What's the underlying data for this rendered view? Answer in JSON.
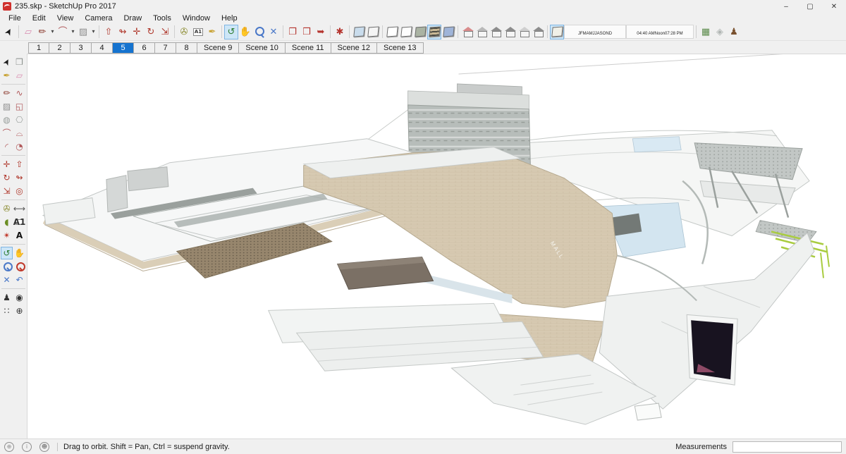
{
  "window": {
    "title": "235.skp - SketchUp Pro 2017",
    "controls": [
      {
        "name": "minimize-button",
        "glyph": "–"
      },
      {
        "name": "maximize-button",
        "glyph": "▢"
      },
      {
        "name": "close-button",
        "glyph": "✕"
      }
    ]
  },
  "menu": {
    "items": [
      "File",
      "Edit",
      "View",
      "Camera",
      "Draw",
      "Tools",
      "Window",
      "Help"
    ]
  },
  "toolbar": {
    "groups": [
      {
        "icons": [
          {
            "name": "select-tool-icon",
            "glyph": "➤",
            "color": "#1a1a1a",
            "cls": "rot-up"
          }
        ]
      },
      {
        "icons": [
          {
            "name": "eraser-tool-icon",
            "glyph": "▱",
            "color": "#d98cb0"
          },
          {
            "name": "line-tool-icon",
            "glyph": "✏",
            "color": "#8b3a2e"
          },
          {
            "name": "line-dropdown-icon",
            "kind": "drop",
            "glyph": "▾"
          },
          {
            "name": "arc-tool-icon",
            "glyph": "⌒",
            "color": "#b0585a"
          },
          {
            "name": "arc-dropdown-icon",
            "kind": "drop",
            "glyph": "▾"
          },
          {
            "name": "rectangle-tool-icon",
            "glyph": "▨",
            "color": "#8d8d8d"
          },
          {
            "name": "rectangle-dropdown-icon",
            "kind": "drop",
            "glyph": "▾"
          }
        ]
      },
      {
        "icons": [
          {
            "name": "pushpull-tool-icon",
            "glyph": "⇧",
            "color": "#b03a2e"
          },
          {
            "name": "followme-tool-icon",
            "glyph": "↬",
            "color": "#b03a2e"
          },
          {
            "name": "move-tool-icon",
            "glyph": "✛",
            "color": "#b03a2e"
          },
          {
            "name": "rotate-tool-icon",
            "glyph": "↻",
            "color": "#b03a2e"
          },
          {
            "name": "scale-tool-icon",
            "glyph": "⇲",
            "color": "#b03a2e"
          }
        ]
      },
      {
        "icons": [
          {
            "name": "tape-measure-tool-icon",
            "glyph": "✇",
            "color": "#8a8a2e"
          },
          {
            "name": "text-tool-icon",
            "kind": "badge",
            "glyph": "A1"
          },
          {
            "name": "paint-bucket-tool-icon",
            "glyph": "✒",
            "color": "#c8a233"
          }
        ]
      },
      {
        "icons": [
          {
            "name": "orbit-tool-icon",
            "glyph": "↺",
            "color": "#2e7d32",
            "active": true
          },
          {
            "name": "pan-tool-icon",
            "glyph": "✋",
            "color": "#d8b06a"
          },
          {
            "name": "zoom-tool-icon",
            "kind": "mag"
          },
          {
            "name": "zoom-extents-icon",
            "glyph": "✕",
            "color": "#4a78c8"
          }
        ]
      },
      {
        "icons": [
          {
            "name": "get-models-icon",
            "glyph": "❐",
            "color": "#b5342e"
          },
          {
            "name": "share-model-icon",
            "glyph": "❒",
            "color": "#b5342e"
          },
          {
            "name": "send-model-icon",
            "glyph": "➥",
            "color": "#b5342e"
          }
        ]
      },
      {
        "icons": [
          {
            "name": "extension-warehouse-icon",
            "glyph": "✱",
            "color": "#b5342e"
          }
        ]
      },
      {
        "icons": [
          {
            "name": "xray-style-icon",
            "kind": "cube",
            "color": "#c9dcec"
          },
          {
            "name": "back-edges-style-icon",
            "kind": "cube",
            "color": "#f5f5f5"
          }
        ]
      },
      {
        "icons": [
          {
            "name": "wireframe-style-icon",
            "kind": "cube",
            "color": "#ffffff"
          },
          {
            "name": "hidden-line-style-icon",
            "kind": "cube",
            "color": "#fdfdfd"
          },
          {
            "name": "shaded-style-icon",
            "kind": "cube",
            "color": "#aab3a3"
          },
          {
            "name": "shaded-textures-style-icon",
            "kind": "cubetex",
            "color": "#c9b896",
            "active": true
          },
          {
            "name": "monochrome-style-icon",
            "kind": "cube",
            "color": "#9fb4d8"
          }
        ]
      },
      {
        "icons": [
          {
            "name": "iso-view-icon",
            "kind": "house",
            "color": "#d98c8c"
          },
          {
            "name": "top-view-icon",
            "kind": "house",
            "color": "#b9b9b9"
          },
          {
            "name": "front-view-icon",
            "kind": "house",
            "color": "#8d8d8d"
          },
          {
            "name": "right-view-icon",
            "kind": "house",
            "color": "#8d8d8d"
          },
          {
            "name": "back-view-icon",
            "kind": "house",
            "color": "#cfcfcf"
          },
          {
            "name": "left-view-icon",
            "kind": "house",
            "color": "#8d8d8d"
          }
        ]
      },
      {
        "icons": [
          {
            "name": "shadows-toggle-icon",
            "kind": "cube",
            "color": "#f0f0e8",
            "active": true
          },
          {
            "name": "shadow-month-slider",
            "kind": "months"
          },
          {
            "name": "shadow-time-slider",
            "kind": "times"
          }
        ]
      },
      {
        "icons": [
          {
            "name": "add-location-icon",
            "glyph": "▦",
            "color": "#5a8a4a"
          },
          {
            "name": "toggle-terrain-icon",
            "glyph": "◈",
            "color": "#b0b5b3"
          },
          {
            "name": "photo-textures-icon",
            "glyph": "♟",
            "color": "#7a5230"
          }
        ]
      }
    ],
    "shadow": {
      "months": [
        "J",
        "F",
        "M",
        "A",
        "M",
        "J",
        "J",
        "A",
        "S",
        "O",
        "N",
        "D"
      ],
      "time_start": "04:40 AM",
      "time_mid": "Noon",
      "time_end": "07:28 PM"
    }
  },
  "scene_tabs": {
    "tabs": [
      {
        "label": "1"
      },
      {
        "label": "2"
      },
      {
        "label": "3"
      },
      {
        "label": "4"
      },
      {
        "label": "5",
        "active": true
      },
      {
        "label": "6"
      },
      {
        "label": "7"
      },
      {
        "label": "8"
      },
      {
        "label": "Scene 9"
      },
      {
        "label": "Scene 10"
      },
      {
        "label": "Scene 11"
      },
      {
        "label": "Scene 12"
      },
      {
        "label": "Scene 13"
      }
    ]
  },
  "left_toolbar": {
    "tools": [
      {
        "name": "select-tool",
        "glyph": "➤",
        "color": "#1a1a1a",
        "cls": "rot-up"
      },
      {
        "name": "make-component-tool",
        "glyph": "❒",
        "color": "#8a8f8c"
      },
      {
        "name": "paint-bucket-tool",
        "glyph": "✒",
        "color": "#c8a233"
      },
      {
        "name": "eraser-tool",
        "glyph": "▱",
        "color": "#d98cb0"
      },
      {
        "sep": true
      },
      {
        "name": "line-tool",
        "glyph": "✏",
        "color": "#8b3a2e"
      },
      {
        "name": "freehand-tool",
        "glyph": "∿",
        "color": "#b0585a"
      },
      {
        "name": "rectangle-tool",
        "glyph": "▨",
        "color": "#8d8d8d"
      },
      {
        "name": "rotated-rectangle-tool",
        "glyph": "◱",
        "color": "#b0585a"
      },
      {
        "name": "circle-tool",
        "glyph": "◍",
        "color": "#9aa09d"
      },
      {
        "name": "polygon-tool",
        "glyph": "⎔",
        "color": "#9aa09d"
      },
      {
        "name": "arc-tool",
        "glyph": "⌒",
        "color": "#b0585a"
      },
      {
        "name": "two-point-arc-tool",
        "glyph": "⌓",
        "color": "#b0585a"
      },
      {
        "name": "three-point-arc-tool",
        "glyph": "◜",
        "color": "#b0585a"
      },
      {
        "name": "pie-tool",
        "glyph": "◔",
        "color": "#b0585a"
      },
      {
        "sep": true
      },
      {
        "name": "move-tool",
        "glyph": "✛",
        "color": "#b03a2e"
      },
      {
        "name": "pushpull-tool",
        "glyph": "⇧",
        "color": "#b03a2e"
      },
      {
        "name": "rotate-tool",
        "glyph": "↻",
        "color": "#b03a2e"
      },
      {
        "name": "followme-tool",
        "glyph": "↬",
        "color": "#b03a2e"
      },
      {
        "name": "scale-tool",
        "glyph": "⇲",
        "color": "#b03a2e"
      },
      {
        "name": "offset-tool",
        "glyph": "◎",
        "color": "#b03a2e"
      },
      {
        "sep": true
      },
      {
        "name": "tape-measure-tool",
        "glyph": "✇",
        "color": "#8a8a2e"
      },
      {
        "name": "dimension-tool",
        "glyph": "⟷",
        "color": "#555555"
      },
      {
        "name": "protractor-tool",
        "glyph": "◖",
        "color": "#6b8e23"
      },
      {
        "name": "text-tool",
        "kind": "badge",
        "glyph": "A1"
      },
      {
        "name": "axes-tool",
        "glyph": "✴",
        "color": "#c0392b"
      },
      {
        "name": "threed-text-tool",
        "glyph": "A",
        "color": "#111111",
        "cls": "bold"
      },
      {
        "sep": true
      },
      {
        "name": "orbit-tool",
        "glyph": "↺",
        "color": "#2e7d32",
        "active": true
      },
      {
        "name": "pan-tool",
        "glyph": "✋",
        "color": "#d8b06a"
      },
      {
        "name": "zoom-tool",
        "kind": "mag"
      },
      {
        "name": "zoom-window-tool",
        "kind": "magred"
      },
      {
        "name": "zoom-extents-tool",
        "glyph": "✕",
        "color": "#4a78c8"
      },
      {
        "name": "previous-view-tool",
        "glyph": "↶",
        "color": "#4a78c8"
      },
      {
        "sep": true
      },
      {
        "name": "position-camera-tool",
        "glyph": "♟",
        "color": "#333333"
      },
      {
        "name": "look-around-tool",
        "glyph": "◉",
        "color": "#333333"
      },
      {
        "name": "walk-tool",
        "glyph": "∷",
        "color": "#333333"
      },
      {
        "name": "section-plane-tool",
        "glyph": "⊕",
        "color": "#333333"
      }
    ]
  },
  "viewport": {
    "signage": "MALL"
  },
  "status_bar": {
    "icons": [
      {
        "name": "geolocation-status-icon",
        "glyph": "⊕"
      },
      {
        "name": "credit-status-icon",
        "glyph": "i"
      },
      {
        "name": "signin-status-icon",
        "glyph": "☻"
      }
    ],
    "hint": "Drag to orbit. Shift = Pan, Ctrl = suspend gravity.",
    "measurements_label": "Measurements"
  }
}
